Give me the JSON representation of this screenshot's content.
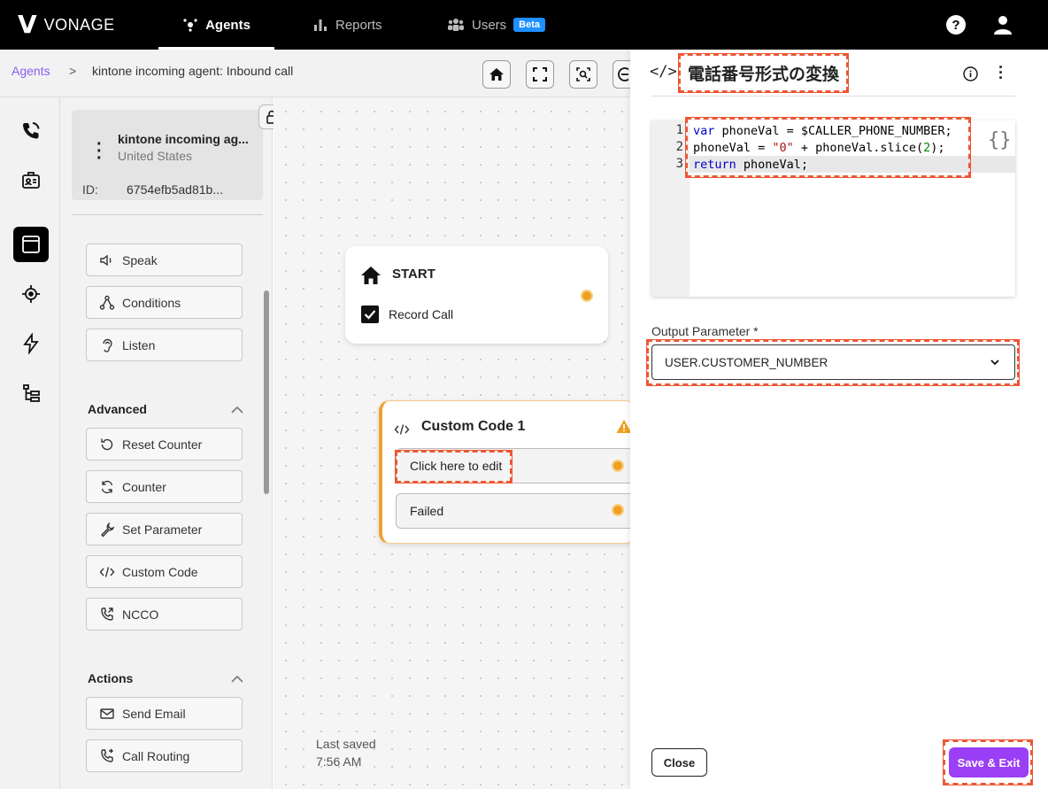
{
  "brand": {
    "logo_mark": "V",
    "name": "VONAGE"
  },
  "topnav": {
    "tabs": [
      {
        "label": "Agents",
        "icon": "agents-icon",
        "active": true
      },
      {
        "label": "Reports",
        "icon": "bar-chart-icon",
        "active": false
      },
      {
        "label": "Users",
        "icon": "users-icon",
        "badge": "Beta",
        "active": false
      }
    ],
    "help_icon": "help-icon",
    "profile_icon": "user-icon"
  },
  "breadcrumb": {
    "root": "Agents",
    "separator": ">",
    "current": "kintone incoming agent: Inbound call"
  },
  "agent_card": {
    "name": "kintone incoming ag...",
    "country": "United States",
    "id_label": "ID:",
    "id_value": "6754efb5ad81b..."
  },
  "palette": {
    "items_top": [
      "Speak",
      "Conditions",
      "Listen"
    ],
    "advanced": {
      "title": "Advanced",
      "items": [
        "Reset Counter",
        "Counter",
        "Set Parameter",
        "Custom Code",
        "NCCO"
      ]
    },
    "actions": {
      "title": "Actions",
      "items": [
        "Send Email",
        "Call Routing"
      ]
    }
  },
  "canvas": {
    "start_node": {
      "title": "START",
      "checkbox_label": "Record Call",
      "checked": true
    },
    "custom_code_node": {
      "title": "Custom Code 1",
      "edit_label": "Click here to edit",
      "failed_label": "Failed"
    },
    "last_saved_label": "Last saved",
    "last_saved_time": "7:56 AM"
  },
  "panel": {
    "header_icon": "</>",
    "title": "電話番号形式の変換",
    "code_lines": [
      "1",
      "2",
      "3"
    ],
    "code_tokens": {
      "l1_kw": "var",
      "l1_rest": " phoneVal = $CALLER_PHONE_NUMBER;",
      "l2_a": "phoneVal = ",
      "l2_str": "\"0\"",
      "l2_b": " + phoneVal.slice(",
      "l2_num": "2",
      "l2_c": ");",
      "l3_kw": "return",
      "l3_rest": " phoneVal;"
    },
    "braces": "{}",
    "output_label": "Output Parameter *",
    "output_value": "USER.CUSTOMER_NUMBER",
    "close_label": "Close",
    "save_label": "Save & Exit"
  },
  "colors": {
    "accent_purple": "#9a3ff5",
    "breadcrumb_link": "#8b5cf6",
    "beta_badge": "#1e90ff",
    "port_orange": "#f0a020",
    "annotation_red": "#e53"
  }
}
